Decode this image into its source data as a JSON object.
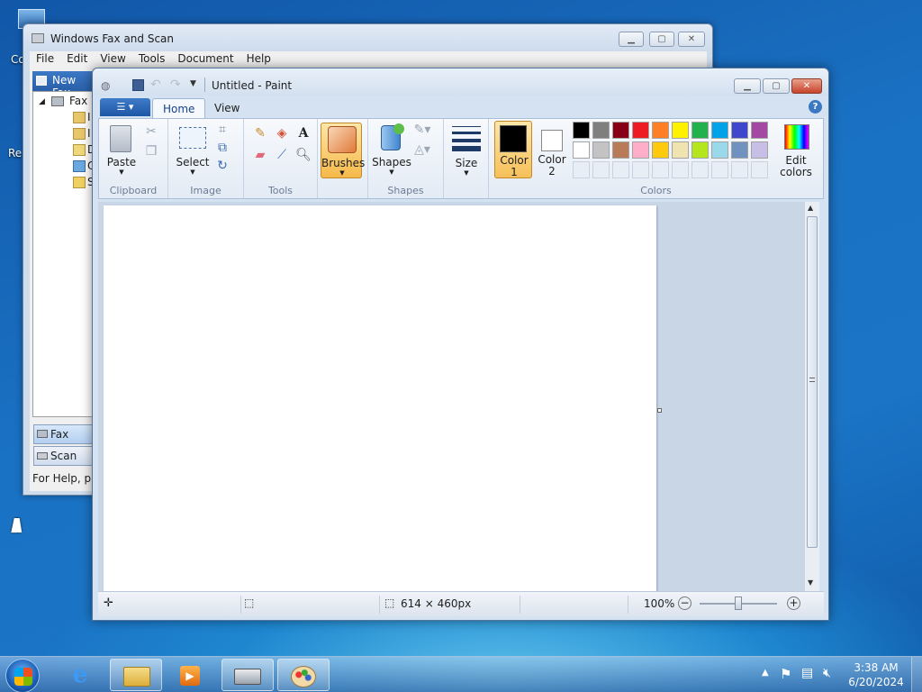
{
  "desktop": {
    "icon_labels": [
      "Co",
      "Re"
    ]
  },
  "fax_window": {
    "title": "Windows Fax and Scan",
    "menu": [
      "File",
      "Edit",
      "View",
      "Tools",
      "Document",
      "Help"
    ],
    "new_fax_label": "New Fax",
    "tree_root": "Fax",
    "tree_items": [
      "I",
      "I",
      "D",
      "O",
      "S"
    ],
    "fax_button": "Fax",
    "scan_button": "Scan",
    "status_text": "For Help, pre"
  },
  "paint": {
    "title": "Untitled - Paint",
    "tabs": [
      "Home",
      "View"
    ],
    "help_glyph": "?",
    "groups": {
      "clipboard": "Clipboard",
      "image": "Image",
      "tools": "Tools",
      "shapes": "Shapes",
      "colors": "Colors"
    },
    "buttons": {
      "paste": "Paste",
      "select": "Select",
      "brushes": "Brushes",
      "shapes": "Shapes",
      "size": "Size",
      "color1_line1": "Color",
      "color1_line2": "1",
      "color2_line1": "Color",
      "color2_line2": "2",
      "edit_colors_line1": "Edit",
      "edit_colors_line2": "colors"
    },
    "colors": {
      "color1": "#000000",
      "color2": "#ffffff",
      "palette_row1": [
        "#000000",
        "#7f7f7f",
        "#880015",
        "#ed1c24",
        "#ff7f27",
        "#fff200",
        "#22b14c",
        "#00a2e8",
        "#3f48cc",
        "#a349a4"
      ],
      "palette_row2": [
        "#ffffff",
        "#c3c3c3",
        "#b97a57",
        "#ffaec9",
        "#ffc90e",
        "#efe4b0",
        "#b5e61d",
        "#99d9ea",
        "#7092be",
        "#c8bfe7"
      ]
    },
    "status": {
      "dimensions": "614 × 460px",
      "zoom": "100%"
    }
  },
  "taskbar": {
    "clock_time": "3:38 AM",
    "clock_date": "6/20/2024"
  }
}
